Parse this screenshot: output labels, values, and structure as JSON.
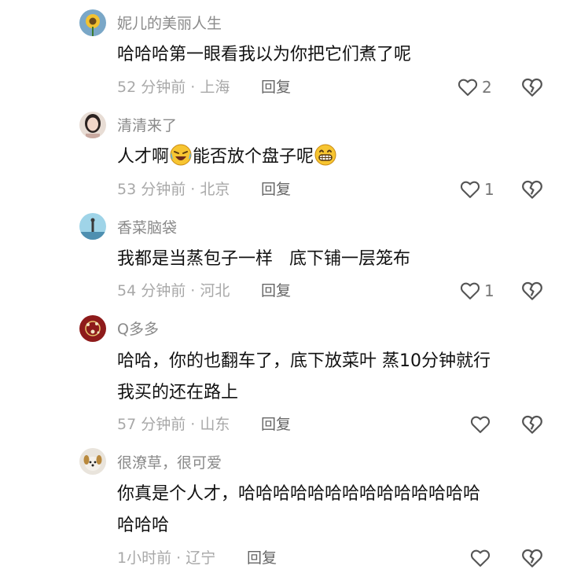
{
  "comments": [
    {
      "username": "妮儿的美丽人生",
      "text": "哈哈哈第一眼看我以为你把它们煮了呢",
      "meta": "52 分钟前 · 上海",
      "reply_label": "回复",
      "likes": "2",
      "avatar_icon": "sunflower-avatar"
    },
    {
      "username": "清清来了",
      "text_before": "人才啊",
      "emoji1": "laughing-crying-emoji",
      "text_middle": "能否放个盘子呢",
      "emoji2": "grinning-emoji",
      "meta": "53 分钟前 · 北京",
      "reply_label": "回复",
      "likes": "1",
      "avatar_icon": "woman-portrait-avatar"
    },
    {
      "username": "香菜脑袋",
      "text": "我都是当蒸包子一样   底下铺一层笼布",
      "meta": "54 分钟前 · 河北",
      "reply_label": "回复",
      "likes": "1",
      "avatar_icon": "sky-figure-avatar"
    },
    {
      "username": "Q多多",
      "text_line1": "哈哈，你的也翻车了，底下放菜叶 蒸10分钟就行",
      "text_line2": "我买的还在路上",
      "meta": "57 分钟前 · 山东",
      "reply_label": "回复",
      "likes": "",
      "avatar_icon": "red-pattern-avatar"
    },
    {
      "username": "很潦草，很可爱",
      "text_line1": "你真是个人才，哈哈哈哈哈哈哈哈哈哈哈哈哈哈",
      "text_line2": "哈哈哈",
      "meta": "1小时前 · 辽宁",
      "reply_label": "回复",
      "likes": "",
      "avatar_icon": "puppy-avatar"
    }
  ],
  "colors": {
    "username": "#8a8a8a",
    "text": "#111111",
    "meta": "#a8a8a8",
    "icon": "#555555"
  }
}
